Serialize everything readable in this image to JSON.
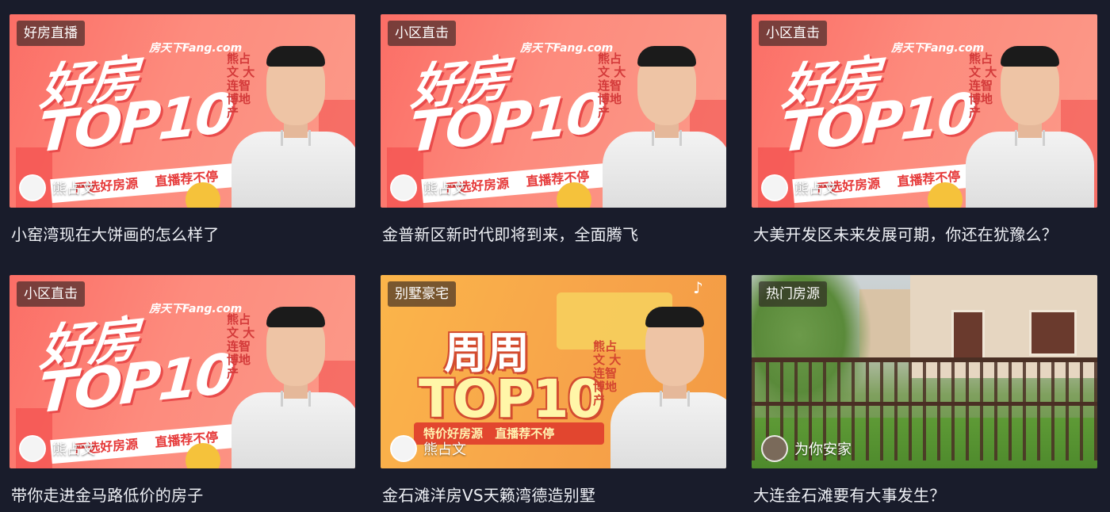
{
  "grid": {
    "cards": [
      {
        "tag": "好房直播",
        "poster": {
          "brand": "房天下Fang.com",
          "line1": "好房",
          "line2": "TOP10",
          "vertical_text": "熊占文 大连智博地产",
          "ribbon": "严选好房源 直播荐不停"
        },
        "author": "熊占文",
        "title": "小窑湾现在大饼画的怎么样了"
      },
      {
        "tag": "小区直击",
        "poster": {
          "brand": "房天下Fang.com",
          "line1": "好房",
          "line2": "TOP10",
          "vertical_text": "熊占文 大连智博地产",
          "ribbon": "严选好房源 直播荐不停"
        },
        "author": "熊占文",
        "title": "金普新区新时代即将到来，全面腾飞"
      },
      {
        "tag": "小区直击",
        "poster": {
          "brand": "房天下Fang.com",
          "line1": "好房",
          "line2": "TOP10",
          "vertical_text": "熊占文 大连智博地产",
          "ribbon": "严选好房源 直播荐不停"
        },
        "author": "熊占文",
        "title": "大美开发区未来发展可期，你还在犹豫么？"
      },
      {
        "tag": "小区直击",
        "poster": {
          "brand": "房天下Fang.com",
          "line1": "好房",
          "line2": "TOP10",
          "vertical_text": "熊占文 大连智博地产",
          "ribbon": "严选好房源 直播荐不停"
        },
        "author": "熊占文",
        "title": "带你走进金马路低价的房子"
      },
      {
        "tag": "别墅豪宅",
        "poster": {
          "line1": "周周",
          "line2": "TOP10",
          "vertical_text": "熊占文 大连智博地产",
          "ribbon": "特价好房源 直播荐不停"
        },
        "author": "熊占文",
        "title": "金石滩洋房VS天籁湾德造别墅"
      },
      {
        "tag": "热门房源",
        "author": "为你安家",
        "title": "大连金石滩要有大事发生？"
      }
    ]
  },
  "colors": {
    "background": "#191c2b",
    "title_text": "#eef0f5",
    "pink_poster": "#fb7b6f",
    "orange_poster": "#f8ab48"
  },
  "icons": {
    "music_note": "music-note-icon"
  }
}
